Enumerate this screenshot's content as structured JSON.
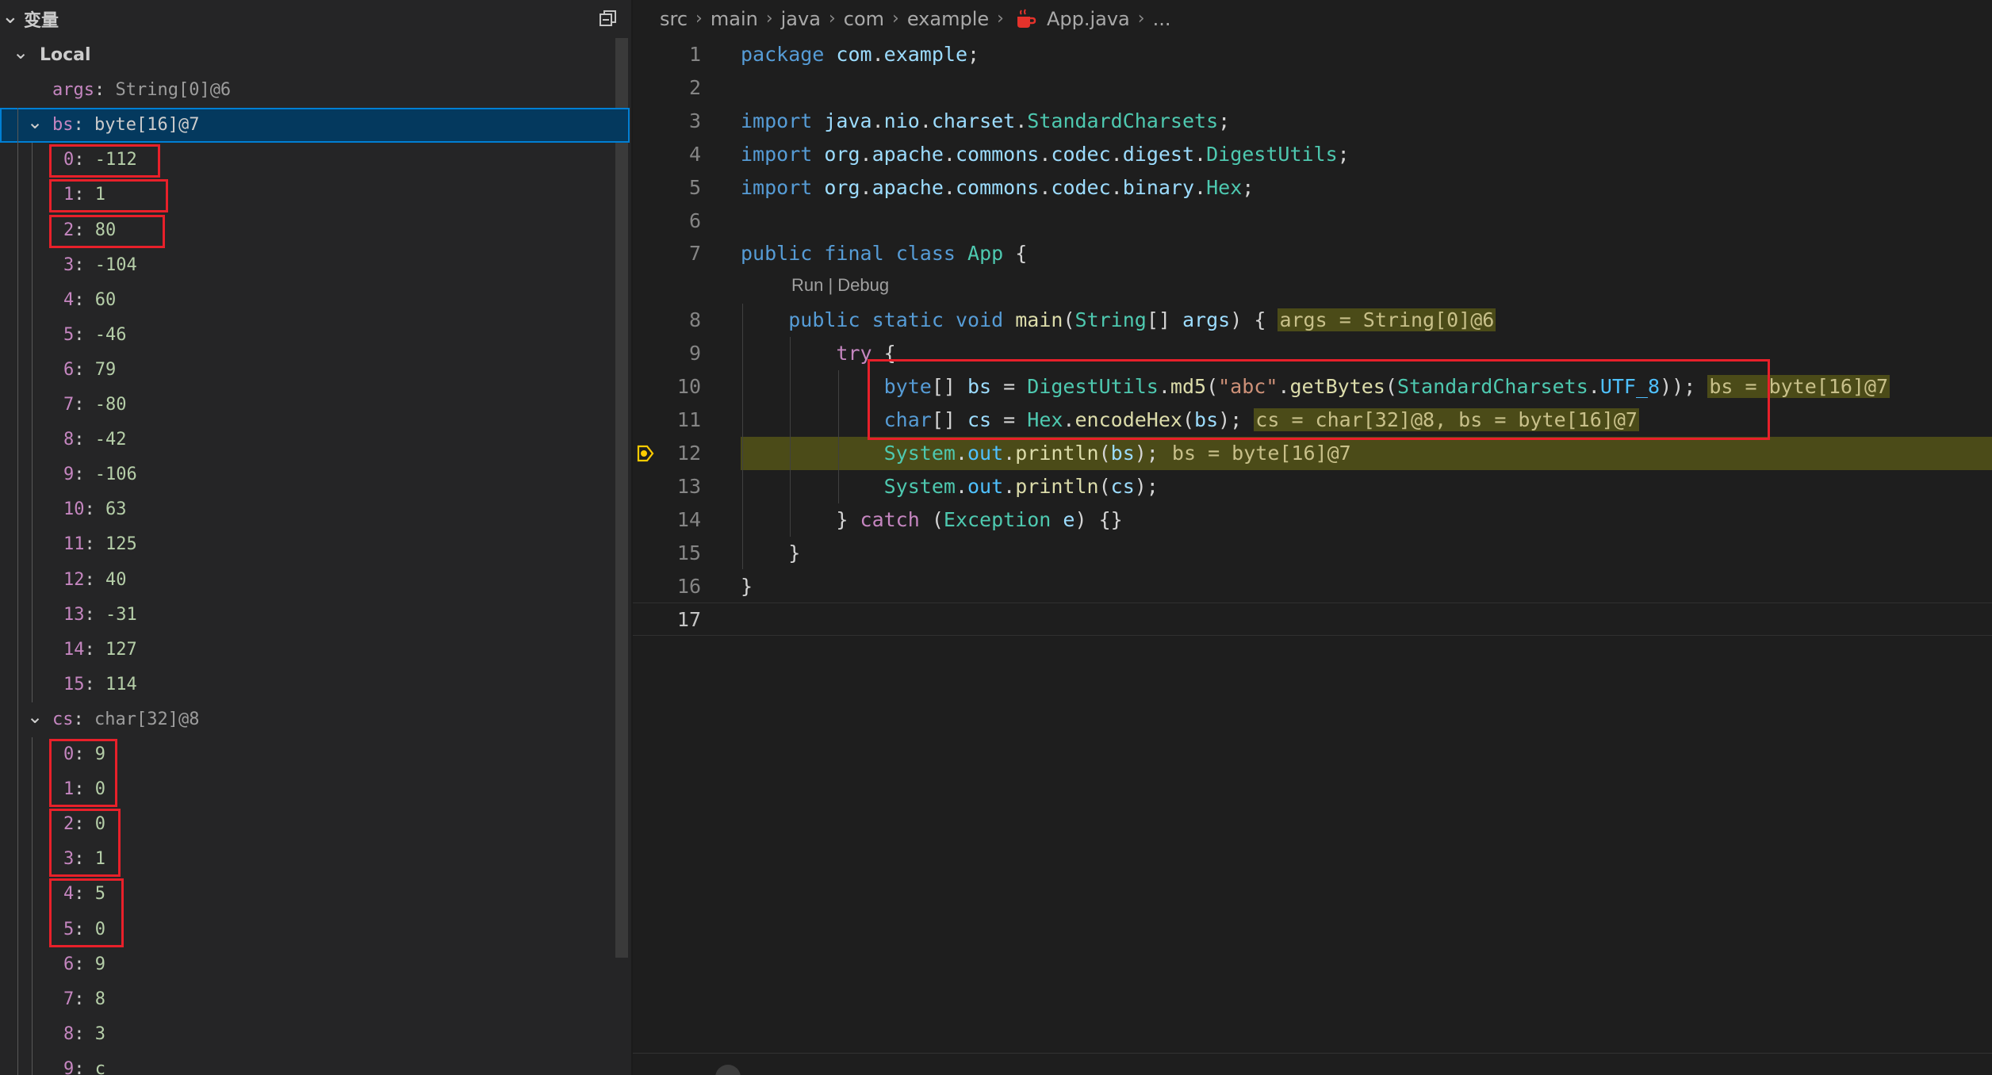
{
  "variables_panel": {
    "title": "变量",
    "scope_label": "Local",
    "args": {
      "name": "args",
      "value": "String[0]@6"
    },
    "bs": {
      "name": "bs",
      "value": "byte[16]@7",
      "items": [
        {
          "index": "0",
          "value": "-112"
        },
        {
          "index": "1",
          "value": "1"
        },
        {
          "index": "2",
          "value": "80"
        },
        {
          "index": "3",
          "value": "-104"
        },
        {
          "index": "4",
          "value": "60"
        },
        {
          "index": "5",
          "value": "-46"
        },
        {
          "index": "6",
          "value": "79"
        },
        {
          "index": "7",
          "value": "-80"
        },
        {
          "index": "8",
          "value": "-42"
        },
        {
          "index": "9",
          "value": "-106"
        },
        {
          "index": "10",
          "value": "63"
        },
        {
          "index": "11",
          "value": "125"
        },
        {
          "index": "12",
          "value": "40"
        },
        {
          "index": "13",
          "value": "-31"
        },
        {
          "index": "14",
          "value": "127"
        },
        {
          "index": "15",
          "value": "114"
        }
      ]
    },
    "cs": {
      "name": "cs",
      "value": "char[32]@8",
      "items": [
        {
          "index": "0",
          "value": "9"
        },
        {
          "index": "1",
          "value": "0"
        },
        {
          "index": "2",
          "value": "0"
        },
        {
          "index": "3",
          "value": "1"
        },
        {
          "index": "4",
          "value": "5"
        },
        {
          "index": "5",
          "value": "0"
        },
        {
          "index": "6",
          "value": "9"
        },
        {
          "index": "7",
          "value": "8"
        },
        {
          "index": "8",
          "value": "3"
        },
        {
          "index": "9",
          "value": "c"
        }
      ]
    }
  },
  "breadcrumb": [
    "src",
    "main",
    "java",
    "com",
    "example",
    "App.java",
    "..."
  ],
  "editor": {
    "codelens": "Run | Debug",
    "current_line": 12,
    "lines": [
      {
        "n": "1",
        "tokens": [
          [
            "kw",
            "package"
          ],
          [
            "pl",
            " "
          ],
          [
            "var",
            "com"
          ],
          [
            "pl",
            "."
          ],
          [
            "var",
            "example"
          ],
          [
            "pl",
            ";"
          ]
        ]
      },
      {
        "n": "2",
        "tokens": []
      },
      {
        "n": "3",
        "tokens": [
          [
            "kw",
            "import"
          ],
          [
            "pl",
            " "
          ],
          [
            "var",
            "java"
          ],
          [
            "pl",
            "."
          ],
          [
            "var",
            "nio"
          ],
          [
            "pl",
            "."
          ],
          [
            "var",
            "charset"
          ],
          [
            "pl",
            "."
          ],
          [
            "type",
            "StandardCharsets"
          ],
          [
            "pl",
            ";"
          ]
        ]
      },
      {
        "n": "4",
        "tokens": [
          [
            "kw",
            "import"
          ],
          [
            "pl",
            " "
          ],
          [
            "var",
            "org"
          ],
          [
            "pl",
            "."
          ],
          [
            "var",
            "apache"
          ],
          [
            "pl",
            "."
          ],
          [
            "var",
            "commons"
          ],
          [
            "pl",
            "."
          ],
          [
            "var",
            "codec"
          ],
          [
            "pl",
            "."
          ],
          [
            "var",
            "digest"
          ],
          [
            "pl",
            "."
          ],
          [
            "type",
            "DigestUtils"
          ],
          [
            "pl",
            ";"
          ]
        ]
      },
      {
        "n": "5",
        "tokens": [
          [
            "kw",
            "import"
          ],
          [
            "pl",
            " "
          ],
          [
            "var",
            "org"
          ],
          [
            "pl",
            "."
          ],
          [
            "var",
            "apache"
          ],
          [
            "pl",
            "."
          ],
          [
            "var",
            "commons"
          ],
          [
            "pl",
            "."
          ],
          [
            "var",
            "codec"
          ],
          [
            "pl",
            "."
          ],
          [
            "var",
            "binary"
          ],
          [
            "pl",
            "."
          ],
          [
            "type",
            "Hex"
          ],
          [
            "pl",
            ";"
          ]
        ]
      },
      {
        "n": "6",
        "tokens": []
      },
      {
        "n": "7",
        "tokens": [
          [
            "kw",
            "public"
          ],
          [
            "pl",
            " "
          ],
          [
            "kw",
            "final"
          ],
          [
            "pl",
            " "
          ],
          [
            "kw",
            "class"
          ],
          [
            "pl",
            " "
          ],
          [
            "type",
            "App"
          ],
          [
            "pl",
            " {"
          ]
        ]
      },
      {
        "n": "8",
        "tokens": [
          [
            "pl",
            "    "
          ],
          [
            "kw",
            "public"
          ],
          [
            "pl",
            " "
          ],
          [
            "kw",
            "static"
          ],
          [
            "pl",
            " "
          ],
          [
            "kw",
            "void"
          ],
          [
            "pl",
            " "
          ],
          [
            "fn",
            "main"
          ],
          [
            "pl",
            "("
          ],
          [
            "type",
            "String"
          ],
          [
            "pl",
            "[] "
          ],
          [
            "var",
            "args"
          ],
          [
            "pl",
            ") { "
          ],
          [
            "inline",
            "args = String[0]@6"
          ]
        ]
      },
      {
        "n": "9",
        "tokens": [
          [
            "pl",
            "        "
          ],
          [
            "ctl",
            "try"
          ],
          [
            "pl",
            " {"
          ]
        ]
      },
      {
        "n": "10",
        "tokens": [
          [
            "pl",
            "            "
          ],
          [
            "kw",
            "byte"
          ],
          [
            "pl",
            "[] "
          ],
          [
            "var",
            "bs"
          ],
          [
            "pl",
            " = "
          ],
          [
            "type",
            "DigestUtils"
          ],
          [
            "pl",
            "."
          ],
          [
            "fn",
            "md5"
          ],
          [
            "pl",
            "("
          ],
          [
            "str",
            "\"abc\""
          ],
          [
            "pl",
            "."
          ],
          [
            "fn",
            "getBytes"
          ],
          [
            "pl",
            "("
          ],
          [
            "type",
            "StandardCharsets"
          ],
          [
            "pl",
            "."
          ],
          [
            "const",
            "UTF_8"
          ],
          [
            "pl",
            "));"
          ],
          [
            "pl",
            " "
          ],
          [
            "inline",
            "bs = byte[16]@7"
          ]
        ]
      },
      {
        "n": "11",
        "tokens": [
          [
            "pl",
            "            "
          ],
          [
            "kw",
            "char"
          ],
          [
            "pl",
            "[] "
          ],
          [
            "var",
            "cs"
          ],
          [
            "pl",
            " = "
          ],
          [
            "type",
            "Hex"
          ],
          [
            "pl",
            "."
          ],
          [
            "fn",
            "encodeHex"
          ],
          [
            "pl",
            "("
          ],
          [
            "var",
            "bs"
          ],
          [
            "pl",
            ");"
          ],
          [
            "pl",
            " "
          ],
          [
            "inline",
            "cs = char[32]@8, bs = byte[16]@7"
          ]
        ]
      },
      {
        "n": "12",
        "tokens": [
          [
            "pl",
            "            "
          ],
          [
            "type",
            "System"
          ],
          [
            "pl",
            "."
          ],
          [
            "const",
            "out"
          ],
          [
            "pl",
            "."
          ],
          [
            "fn",
            "println"
          ],
          [
            "pl",
            "("
          ],
          [
            "var",
            "bs"
          ],
          [
            "pl",
            ");"
          ],
          [
            "pl",
            " "
          ],
          [
            "inline",
            "bs = byte[16]@7"
          ]
        ]
      },
      {
        "n": "13",
        "tokens": [
          [
            "pl",
            "            "
          ],
          [
            "type",
            "System"
          ],
          [
            "pl",
            "."
          ],
          [
            "const",
            "out"
          ],
          [
            "pl",
            "."
          ],
          [
            "fn",
            "println"
          ],
          [
            "pl",
            "("
          ],
          [
            "var",
            "cs"
          ],
          [
            "pl",
            ");"
          ]
        ]
      },
      {
        "n": "14",
        "tokens": [
          [
            "pl",
            "        } "
          ],
          [
            "ctl",
            "catch"
          ],
          [
            "pl",
            " ("
          ],
          [
            "type",
            "Exception"
          ],
          [
            "pl",
            " "
          ],
          [
            "var",
            "e"
          ],
          [
            "pl",
            ") {}"
          ]
        ]
      },
      {
        "n": "15",
        "tokens": [
          [
            "pl",
            "    }"
          ]
        ]
      },
      {
        "n": "16",
        "tokens": [
          [
            "pl",
            "}"
          ]
        ]
      },
      {
        "n": "17",
        "tokens": []
      }
    ]
  },
  "colors": {
    "highlight_box": "#e8202a",
    "current_line_bg": "#4b4b18",
    "selection_bg": "#04395e"
  }
}
